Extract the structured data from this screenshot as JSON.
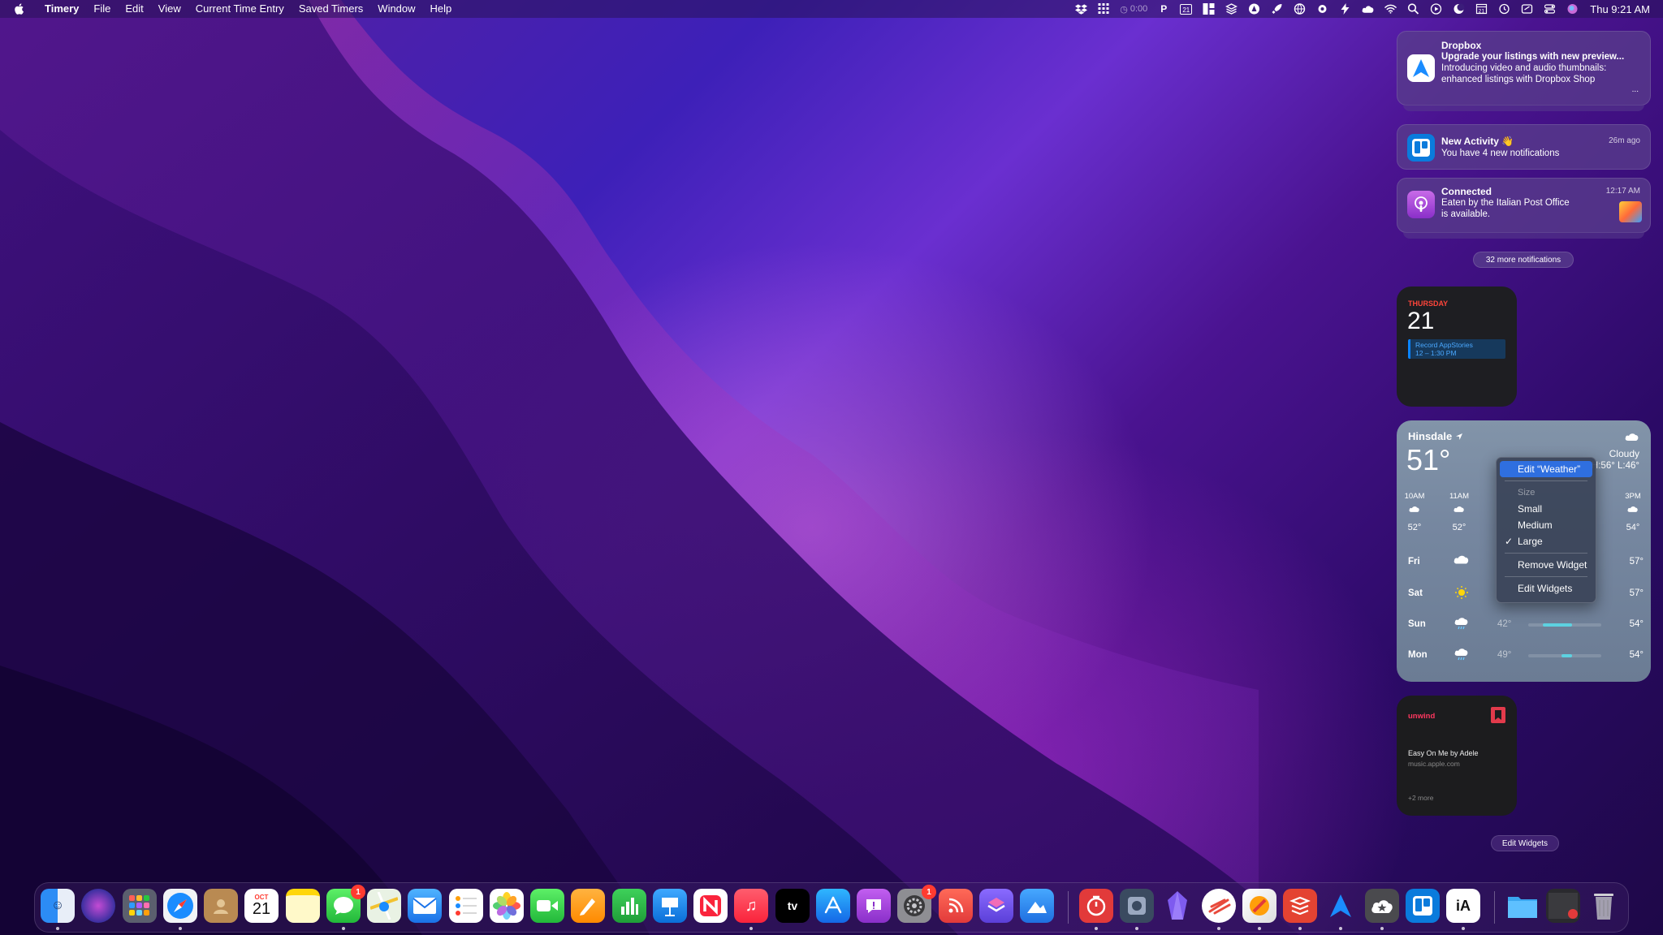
{
  "menubar": {
    "app_name": "Timery",
    "menus": [
      "File",
      "Edit",
      "View",
      "Current Time Entry",
      "Saved Timers",
      "Window",
      "Help"
    ],
    "timer_text": "0:00",
    "calendar_date": "21",
    "clock": "Thu 9:21 AM"
  },
  "notifications": [
    {
      "app": "Dropbox",
      "title": "Dropbox",
      "line1": "Upgrade your listings with new preview...",
      "line2": "Introducing video and audio thumbnails:",
      "line3": "enhanced listings with Dropbox Shop",
      "ellipsis": "...",
      "icon": "spark-arrow-icon"
    },
    {
      "app": "Trello",
      "title": "New Activity 👋",
      "line1": "You have 4 new notifications",
      "time": "26m ago",
      "icon": "trello-icon"
    },
    {
      "app": "Podcasts",
      "title": "Connected",
      "line1": "Eaten by the Italian Post Office",
      "line2": "is available.",
      "time": "12:17 AM",
      "icon": "podcasts-icon"
    }
  ],
  "more_notifications": "32 more notifications",
  "calendar_widget": {
    "day": "THURSDAY",
    "date": "21",
    "event_title": "Record AppStories",
    "event_time": "12 – 1:30 PM"
  },
  "weather": {
    "city": "Hinsdale",
    "temp": "51°",
    "condition": "Cloudy",
    "hilo": "H:56° L:46°",
    "hours": [
      {
        "time": "10AM",
        "temp": "52°"
      },
      {
        "time": "11AM",
        "temp": "52°"
      },
      {
        "time": "3PM",
        "temp": "54°"
      }
    ],
    "days": [
      {
        "name": "Fri",
        "icon": "cloud-icon",
        "lo": "",
        "hi": "57°",
        "bar_from": 0,
        "bar_to": 0
      },
      {
        "name": "Sat",
        "icon": "sun-icon",
        "lo": "",
        "hi": "57°",
        "bar_from": 0,
        "bar_to": 0
      },
      {
        "name": "Sun",
        "icon": "cloud-rain-icon",
        "lo": "42°",
        "hi": "54°",
        "bar_from": 0.2,
        "bar_to": 0.6
      },
      {
        "name": "Mon",
        "icon": "cloud-rain-icon",
        "lo": "49°",
        "hi": "54°",
        "bar_from": 0.45,
        "bar_to": 0.6
      }
    ]
  },
  "context_menu": {
    "edit_weather": "Edit “Weather”",
    "size_header": "Size",
    "small": "Small",
    "medium": "Medium",
    "large": "Large",
    "remove": "Remove Widget",
    "edit_widgets": "Edit Widgets"
  },
  "unwind": {
    "brand": "unwind",
    "item_title": "Easy On Me by Adele",
    "item_url": "music.apple.com",
    "more": "+2 more"
  },
  "edit_widgets_button": "Edit Widgets",
  "dock": {
    "calendar_month": "OCT",
    "calendar_day": "21",
    "messages_badge": "1",
    "settings_badge": "1",
    "tv_label": "tv",
    "ia_label": "iA"
  }
}
